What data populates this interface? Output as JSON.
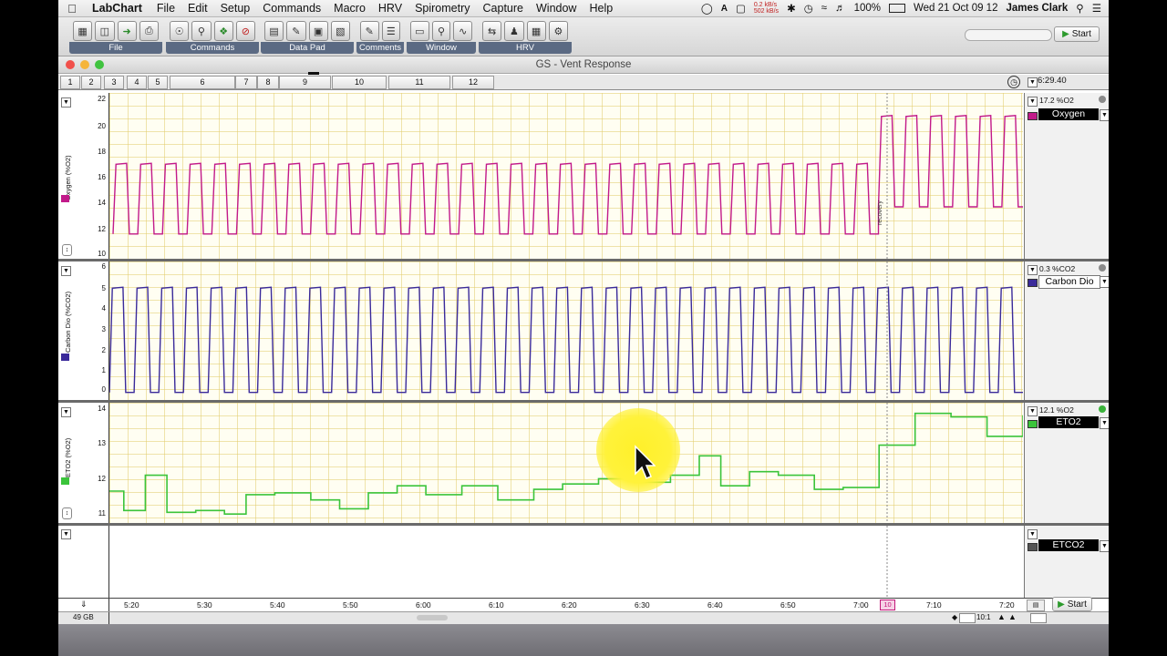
{
  "menubar": {
    "app_name": "LabChart",
    "items": [
      "File",
      "Edit",
      "Setup",
      "Commands",
      "Macro",
      "HRV",
      "Spirometry",
      "Capture",
      "Window",
      "Help"
    ],
    "net_up": "0.2 kB/s",
    "net_down": "502 kB/s",
    "battery": "100%",
    "datetime": "Wed 21 Oct  09 12",
    "user": "James Clark"
  },
  "toolbar": {
    "groups": [
      "File",
      "Commands",
      "Data Pad",
      "Comments",
      "Window",
      "HRV"
    ],
    "start_label": "Start"
  },
  "window": {
    "title": "GS - Vent Response",
    "pages": [
      "1",
      "2",
      "3",
      "4",
      "5",
      "6",
      "7",
      "8",
      "9",
      "10",
      "11",
      "12"
    ],
    "time_display": "6:29.40"
  },
  "channels": [
    {
      "name": "Oxygen",
      "value": "17.2 %O2",
      "axis_label": "Oxygen (%O2)",
      "color": "#c21a8a",
      "yticks": [
        "22",
        "20",
        "18",
        "16",
        "14",
        "12",
        "10"
      ],
      "ylim": [
        10,
        22
      ]
    },
    {
      "name": "Carbon Dio",
      "value": "0.3 %CO2",
      "axis_label": "Carbon Dio (%CO2)",
      "color": "#3a2a9a",
      "yticks": [
        "6",
        "5",
        "4",
        "3",
        "2",
        "1",
        "0"
      ],
      "ylim": [
        0,
        6
      ]
    },
    {
      "name": "ETO2",
      "value": "12.1 %O2",
      "axis_label": "ETO2 (%O2)",
      "color": "#3bc43b",
      "yticks": [
        "14",
        "13",
        "12",
        "11"
      ],
      "ylim": [
        10.8,
        14
      ]
    },
    {
      "name": "ETCO2",
      "value": "",
      "axis_label": "",
      "color": "#555555",
      "yticks": [],
      "ylim": [
        0,
        1
      ]
    }
  ],
  "comment": {
    "text": "recovery",
    "marker": "10"
  },
  "time_axis": {
    "ticks": [
      "5:20",
      "5:30",
      "5:40",
      "5:50",
      "6:00",
      "6:10",
      "6:20",
      "6:30",
      "6:40",
      "6:50",
      "7:00",
      "7:10",
      "7:20"
    ]
  },
  "status": {
    "disk": "49 GB",
    "zoom": "10:1",
    "start_label": "Start"
  },
  "chart_data": [
    {
      "type": "line",
      "name": "Oxygen",
      "x_unit": "m:ss",
      "x_range": [
        "5:16",
        "7:23"
      ],
      "ylabel": "Oxygen (%O2)",
      "ylim": [
        10,
        22
      ],
      "breath_count": 37,
      "baseline_phase": {
        "x_end": "7:01",
        "peak": 16.9,
        "trough": 11.5
      },
      "recovery_phase": {
        "x_start": "7:01",
        "peak": 20.6,
        "trough": 13.6
      }
    },
    {
      "type": "line",
      "name": "Carbon Dio",
      "x_unit": "m:ss",
      "x_range": [
        "5:16",
        "7:23"
      ],
      "ylabel": "Carbon Dio (%CO2)",
      "ylim": [
        0,
        6
      ],
      "breath_count": 37,
      "peak": 5.0,
      "trough": 0.1
    },
    {
      "type": "line",
      "name": "ETO2",
      "ylabel": "ETO2 (%O2)",
      "ylim": [
        10.8,
        14
      ],
      "x": [
        "5:16",
        "5:18",
        "5:21",
        "5:24",
        "5:28",
        "5:32",
        "5:35",
        "5:39",
        "5:44",
        "5:48",
        "5:52",
        "5:56",
        "6:00",
        "6:05",
        "6:10",
        "6:15",
        "6:19",
        "6:24",
        "6:29",
        "6:34",
        "6:38",
        "6:41",
        "6:45",
        "6:49",
        "6:54",
        "6:58",
        "7:03",
        "7:08",
        "7:13",
        "7:18",
        "7:23"
      ],
      "values": [
        11.6,
        11.05,
        12.05,
        11.0,
        11.05,
        10.95,
        11.5,
        11.55,
        11.35,
        11.1,
        11.55,
        11.75,
        11.5,
        11.75,
        11.35,
        11.65,
        11.8,
        11.95,
        11.85,
        12.05,
        12.6,
        11.75,
        12.15,
        12.05,
        11.65,
        11.7,
        12.9,
        13.8,
        13.7,
        13.15,
        13.75
      ]
    }
  ]
}
